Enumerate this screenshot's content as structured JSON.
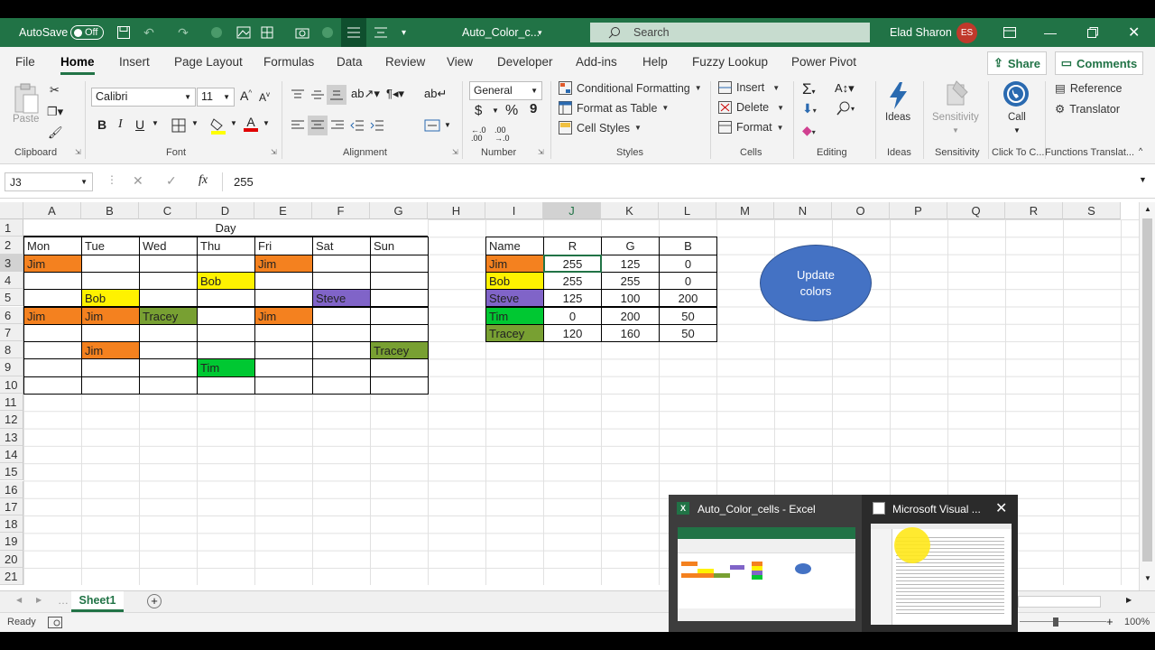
{
  "titlebar": {
    "autosave_label": "AutoSave",
    "autosave_state": "Off",
    "doc_title": "Auto_Color_c...",
    "search_placeholder": "Search",
    "user_name": "Elad Sharon",
    "user_initials": "ES"
  },
  "tabs": [
    "File",
    "Home",
    "Insert",
    "Page Layout",
    "Formulas",
    "Data",
    "Review",
    "View",
    "Developer",
    "Add-ins",
    "Help",
    "Fuzzy Lookup",
    "Power Pivot"
  ],
  "share_label": "Share",
  "comments_label": "Comments",
  "ribbon": {
    "clipboard": {
      "paste": "Paste",
      "label": "Clipboard"
    },
    "font": {
      "name": "Calibri",
      "size": "11",
      "bold": "B",
      "italic": "I",
      "underline": "U",
      "label": "Font"
    },
    "alignment": {
      "label": "Alignment"
    },
    "number": {
      "format": "General",
      "currency": "$",
      "percent": "%",
      "comma": "9",
      "label": "Number"
    },
    "styles": {
      "conditional": "Conditional Formatting",
      "table": "Format as Table",
      "cell_styles": "Cell Styles",
      "label": "Styles"
    },
    "cells": {
      "insert": "Insert",
      "delete": "Delete",
      "format": "Format",
      "label": "Cells"
    },
    "editing": {
      "label": "Editing"
    },
    "ideas": {
      "btn": "Ideas",
      "label": "Ideas"
    },
    "sensitivity": {
      "btn": "Sensitivity",
      "label": "Sensitivity"
    },
    "call": {
      "btn": "Call",
      "label": "Click To C..."
    },
    "functions": {
      "reference": "Reference",
      "translator": "Translator",
      "label": "Functions Translat..."
    }
  },
  "formula_bar": {
    "name_box": "J3",
    "fx": "fx",
    "value": "255"
  },
  "grid": {
    "columns": [
      "A",
      "B",
      "C",
      "D",
      "E",
      "F",
      "G",
      "H",
      "I",
      "J",
      "K",
      "L",
      "M",
      "N",
      "O",
      "P",
      "Q",
      "R",
      "S"
    ],
    "rows": [
      "1",
      "2",
      "3",
      "4",
      "5",
      "6",
      "7",
      "8",
      "9",
      "10",
      "11",
      "12",
      "13",
      "14",
      "15",
      "16",
      "17",
      "18",
      "19",
      "20",
      "21"
    ],
    "day_header": "Day",
    "days": [
      "Mon",
      "Tue",
      "Wed",
      "Thu",
      "Fri",
      "Sat",
      "Sun"
    ],
    "schedule": [
      {
        "row": 3,
        "col": 0,
        "text": "Jim",
        "color": "#F4811F"
      },
      {
        "row": 3,
        "col": 4,
        "text": "Jim",
        "color": "#F4811F"
      },
      {
        "row": 4,
        "col": 3,
        "text": "Bob",
        "color": "#FFF200"
      },
      {
        "row": 5,
        "col": 1,
        "text": "Bob",
        "color": "#FFF200"
      },
      {
        "row": 5,
        "col": 5,
        "text": "Steve",
        "color": "#8064C8"
      },
      {
        "row": 6,
        "col": 0,
        "text": "Jim",
        "color": "#F4811F"
      },
      {
        "row": 6,
        "col": 1,
        "text": "Jim",
        "color": "#F4811F"
      },
      {
        "row": 6,
        "col": 2,
        "text": "Tracey",
        "color": "#78A032"
      },
      {
        "row": 6,
        "col": 4,
        "text": "Jim",
        "color": "#F4811F"
      },
      {
        "row": 8,
        "col": 1,
        "text": "Jim",
        "color": "#F4811F"
      },
      {
        "row": 8,
        "col": 6,
        "text": "Tracey",
        "color": "#78A032"
      },
      {
        "row": 9,
        "col": 3,
        "text": "Tim",
        "color": "#00C832"
      }
    ],
    "rgb_table": {
      "headers": [
        "Name",
        "R",
        "G",
        "B"
      ],
      "rows": [
        {
          "name": "Jim",
          "r": "255",
          "g": "125",
          "b": "0",
          "color": "#F4811F"
        },
        {
          "name": "Bob",
          "r": "255",
          "g": "255",
          "b": "0",
          "color": "#FFF200"
        },
        {
          "name": "Steve",
          "r": "125",
          "g": "100",
          "b": "200",
          "color": "#8064C8"
        },
        {
          "name": "Tim",
          "r": "0",
          "g": "200",
          "b": "50",
          "color": "#00C832"
        },
        {
          "name": "Tracey",
          "r": "120",
          "g": "160",
          "b": "50",
          "color": "#78A032"
        }
      ]
    },
    "button_shape": "Update colors"
  },
  "sheet_tab": "Sheet1",
  "status": {
    "ready": "Ready",
    "zoom": "100%"
  },
  "taskbar_popup": {
    "excel_title": "Auto_Color_cells - Excel",
    "vba_title": "Microsoft Visual ..."
  },
  "colors": {
    "excel_green": "#217346",
    "shape_blue": "#4472C4"
  }
}
